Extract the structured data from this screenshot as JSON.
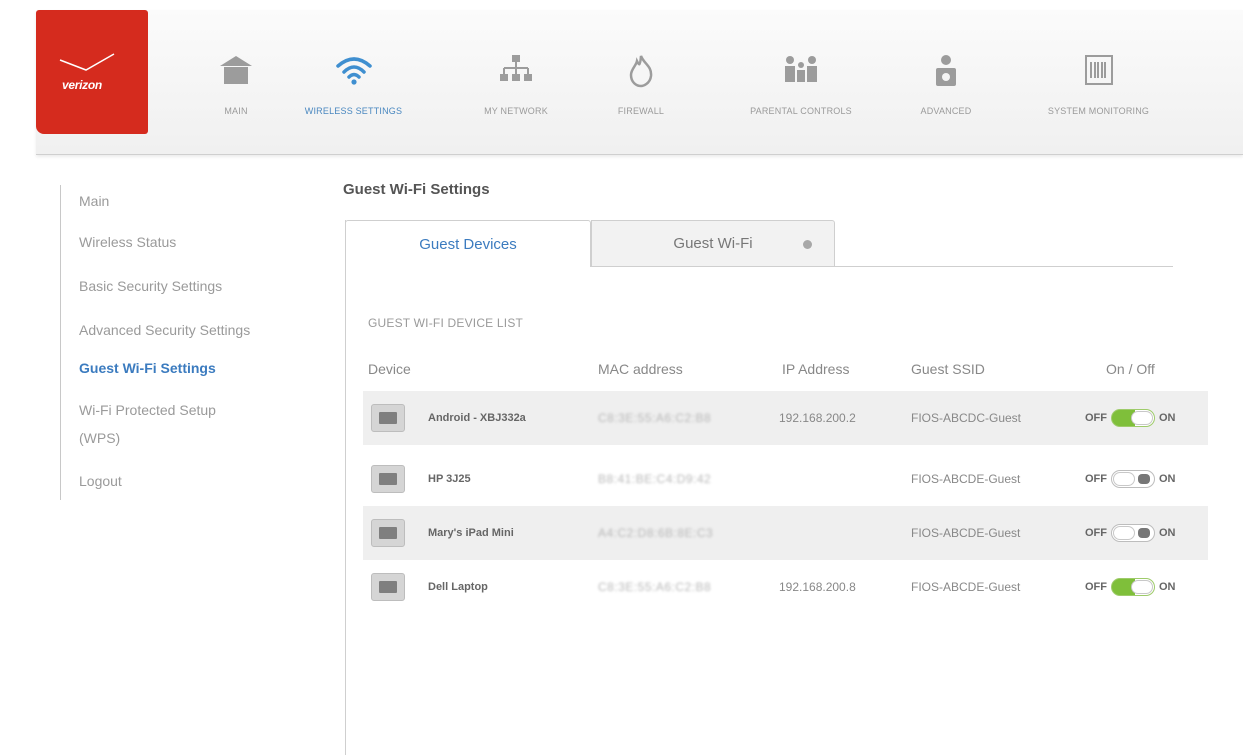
{
  "brand": {
    "logo_text": "verizon",
    "color": "#d52b1e"
  },
  "nav": {
    "items": [
      {
        "label": "MAIN",
        "icon": "home-icon"
      },
      {
        "label": "WIRELESS SETTINGS",
        "icon": "wifi-icon",
        "active": true
      },
      {
        "label": "MY NETWORK",
        "icon": "network-icon"
      },
      {
        "label": "FIREWALL",
        "icon": "fire-icon"
      },
      {
        "label": "PARENTAL CONTROLS",
        "icon": "family-icon"
      },
      {
        "label": "ADVANCED",
        "icon": "user-gear-icon"
      },
      {
        "label": "SYSTEM MONITORING",
        "icon": "monitor-icon"
      }
    ]
  },
  "sidebar": {
    "items": [
      {
        "label": "Main"
      },
      {
        "label": "Wireless Status"
      },
      {
        "label": "Basic Security Settings"
      },
      {
        "label": "Advanced Security Settings"
      },
      {
        "label": "Guest Wi-Fi Settings",
        "active": true
      },
      {
        "label": "Wi-Fi Protected Setup"
      },
      {
        "label": "(WPS)"
      },
      {
        "label": "Logout"
      }
    ]
  },
  "main": {
    "title": "Guest Wi-Fi Settings",
    "tabs": [
      {
        "label": "Guest Devices",
        "active": true
      },
      {
        "label": "Guest Wi-Fi"
      }
    ],
    "list_title": "GUEST WI-FI DEVICE LIST",
    "columns": [
      "Device",
      "MAC address",
      "IP Address",
      "Guest SSID",
      "On / Off"
    ],
    "toggle_off_label": "OFF",
    "toggle_on_label": "ON",
    "rows": [
      {
        "device": "Android - XBJ332a",
        "icon": "tablet-icon",
        "mac": "C8:3E:55:A6:C2:B8",
        "ip": "192.168.200.2",
        "ssid": "FIOS-ABCDC-Guest",
        "on": true
      },
      {
        "device": "HP 3J25",
        "icon": "laptop-icon",
        "mac": "B8:41:BE:C4:D9:42",
        "ip": "",
        "ssid": "FIOS-ABCDE-Guest",
        "on": false
      },
      {
        "device": "Mary's iPad Mini",
        "icon": "tablet-icon",
        "mac": "A4:C2:D8:6B:8E:C3",
        "ip": "",
        "ssid": "FIOS-ABCDE-Guest",
        "on": false
      },
      {
        "device": "Dell Laptop",
        "icon": "laptop-icon",
        "mac": "C8:3E:55:A6:C2:B8",
        "ip": "192.168.200.8",
        "ssid": "FIOS-ABCDE-Guest",
        "on": true
      }
    ]
  }
}
